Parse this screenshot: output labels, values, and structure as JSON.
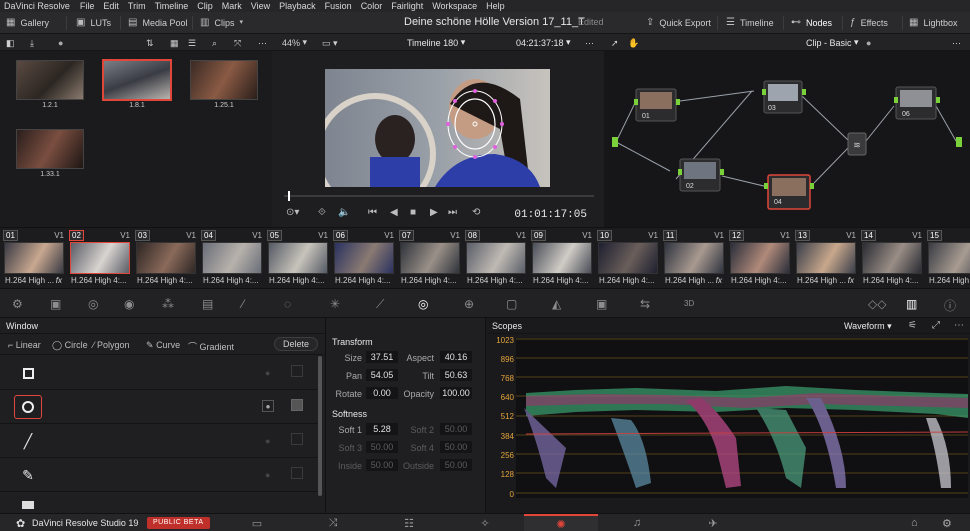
{
  "menubar": {
    "app_name": "DaVinci Resolve",
    "items": [
      "File",
      "Edit",
      "Trim",
      "Timeline",
      "Clip",
      "Mark",
      "View",
      "Playback",
      "Fusion",
      "Color",
      "Fairlight",
      "Workspace",
      "Help"
    ]
  },
  "toolbar": {
    "gallery": "Gallery",
    "luts": "LUTs",
    "media_pool": "Media Pool",
    "clips": "Clips",
    "project_title": "Deine schöne Hölle Version 17_11_T",
    "edited": "Edited",
    "quick_export": "Quick Export",
    "timeline": "Timeline",
    "nodes": "Nodes",
    "effects": "Effects",
    "lightbox": "Lightbox"
  },
  "subbar": {
    "zoom": "44%",
    "timeline_name": "Timeline 180",
    "timecode": "04:21:37:18",
    "node_mode": "Clip - Basic"
  },
  "gallery": {
    "stills": [
      {
        "label": "1.2.1"
      },
      {
        "label": "1.8.1"
      },
      {
        "label": "1.25.1"
      },
      {
        "label": "1.33.1"
      }
    ]
  },
  "viewer": {
    "timecode": "01:01:17:05"
  },
  "nodes": {
    "items": [
      {
        "label": "01"
      },
      {
        "label": "02"
      },
      {
        "label": "03"
      },
      {
        "label": "04"
      },
      {
        "label": "06"
      }
    ]
  },
  "clips": [
    {
      "num": "01",
      "track": "V1",
      "caption": "H.264 High ...",
      "fx": "fx"
    },
    {
      "num": "02",
      "track": "V1",
      "caption": "H.264 High 4:...",
      "fx": ""
    },
    {
      "num": "03",
      "track": "V1",
      "caption": "H.264 High 4:...",
      "fx": ""
    },
    {
      "num": "04",
      "track": "V1",
      "caption": "H.264 High 4:...",
      "fx": ""
    },
    {
      "num": "05",
      "track": "V1",
      "caption": "H.264 High 4:...",
      "fx": ""
    },
    {
      "num": "06",
      "track": "V1",
      "caption": "H.264 High 4:...",
      "fx": ""
    },
    {
      "num": "07",
      "track": "V1",
      "caption": "H.264 High 4:...",
      "fx": ""
    },
    {
      "num": "08",
      "track": "V1",
      "caption": "H.264 High 4:...",
      "fx": ""
    },
    {
      "num": "09",
      "track": "V1",
      "caption": "H.264 High 4:...",
      "fx": ""
    },
    {
      "num": "10",
      "track": "V1",
      "caption": "H.264 High 4:...",
      "fx": ""
    },
    {
      "num": "11",
      "track": "V1",
      "caption": "H.264 High ...",
      "fx": "fx"
    },
    {
      "num": "12",
      "track": "V1",
      "caption": "H.264 High 4:...",
      "fx": ""
    },
    {
      "num": "13",
      "track": "V1",
      "caption": "H.264 High ...",
      "fx": "fx"
    },
    {
      "num": "14",
      "track": "V1",
      "caption": "H.264 High 4:...",
      "fx": ""
    },
    {
      "num": "15",
      "track": "V1",
      "caption": "H.264 High",
      "fx": ""
    }
  ],
  "window": {
    "title": "Window",
    "shapes": {
      "linear": "Linear",
      "circle": "Circle",
      "polygon": "Polygon",
      "curve": "Curve",
      "gradient": "Gradient"
    },
    "delete": "Delete"
  },
  "transform": {
    "title": "Transform",
    "size_label": "Size",
    "size": "37.51",
    "aspect_label": "Aspect",
    "aspect": "40.16",
    "pan_label": "Pan",
    "pan": "54.05",
    "tilt_label": "Tilt",
    "tilt": "50.63",
    "rotate_label": "Rotate",
    "rotate": "0.00",
    "opacity_label": "Opacity",
    "opacity": "100.00"
  },
  "softness": {
    "title": "Softness",
    "soft1_label": "Soft 1",
    "soft1": "5.28",
    "soft2_label": "Soft 2",
    "soft2": "50.00",
    "soft3_label": "Soft 3",
    "soft3": "50.00",
    "soft4_label": "Soft 4",
    "soft4": "50.00",
    "inside_label": "Inside",
    "inside": "50.00",
    "outside_label": "Outside",
    "outside": "50.00"
  },
  "scopes": {
    "title": "Scopes",
    "mode": "Waveform",
    "scale": [
      "1023",
      "896",
      "768",
      "640",
      "512",
      "384",
      "256",
      "128",
      "0"
    ]
  },
  "bottombar": {
    "app_version": "DaVinci Resolve Studio 19",
    "badge": "PUBLIC BETA"
  },
  "colors": {
    "accent": "#e0463a",
    "scope_scale": "#e3a43a"
  }
}
